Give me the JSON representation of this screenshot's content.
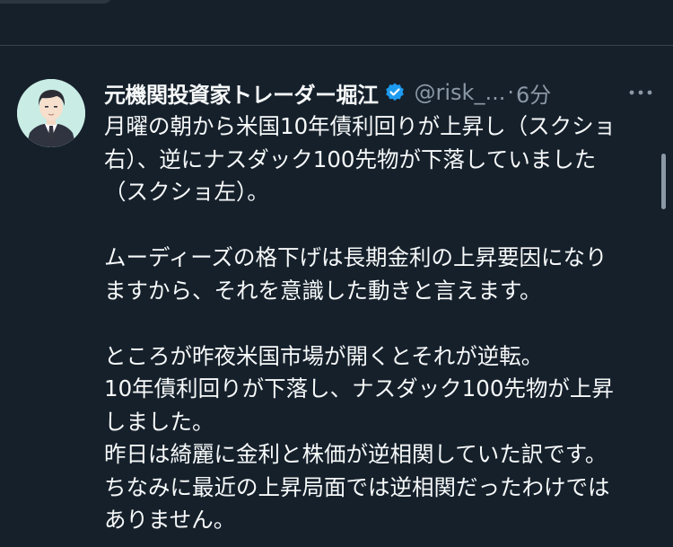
{
  "tweet": {
    "author_name": "元機関投資家トレーダー堀江",
    "handle": "@risk_...",
    "separator": "·",
    "time": "6分",
    "verified_icon": "verified-badge-icon",
    "more_icon": "more-options-icon",
    "accent_color": "#1d9bf0",
    "lines": [
      "月曜の朝から米国10年債利回りが上昇し（スクショ",
      "右）、逆にナスダック100先物が下落していました",
      "（スクショ左）。",
      "",
      "ムーディーズの格下げは長期金利の上昇要因になり",
      "ますから、それを意識した動きと言えます。",
      "",
      "ところが昨夜米国市場が開くとそれが逆転。",
      "10年債利回りが下落し、ナスダック100先物が上昇",
      "しました。",
      "昨日は綺麗に金利と株価が逆相関していた訳です。",
      "ちなみに最近の上昇局面では逆相関だったわけでは",
      "ありません。"
    ]
  }
}
